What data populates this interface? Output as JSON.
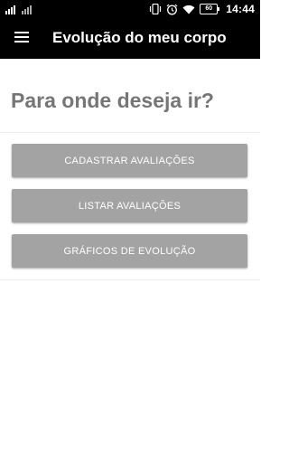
{
  "status_bar": {
    "time": "14:44",
    "battery_level": "60",
    "icons": [
      "signal-icon",
      "sim-icon",
      "vibrate-icon",
      "alarm-icon",
      "wifi-icon",
      "battery-icon"
    ]
  },
  "app_bar": {
    "title": "Evolução do meu corpo",
    "menu_icon": "hamburger-menu-icon"
  },
  "main": {
    "heading": "Para onde deseja ir?",
    "buttons": [
      {
        "label": "CADASTRAR AVALIAÇÕES"
      },
      {
        "label": "LISTAR AVALIAÇÕES"
      },
      {
        "label": "GRÁFICOS DE EVOLUÇÃO"
      }
    ]
  },
  "colors": {
    "app_bar_bg": "#000000",
    "heading_text": "#767676",
    "button_bg": "#a3a3a3",
    "button_text": "#ffffff"
  }
}
